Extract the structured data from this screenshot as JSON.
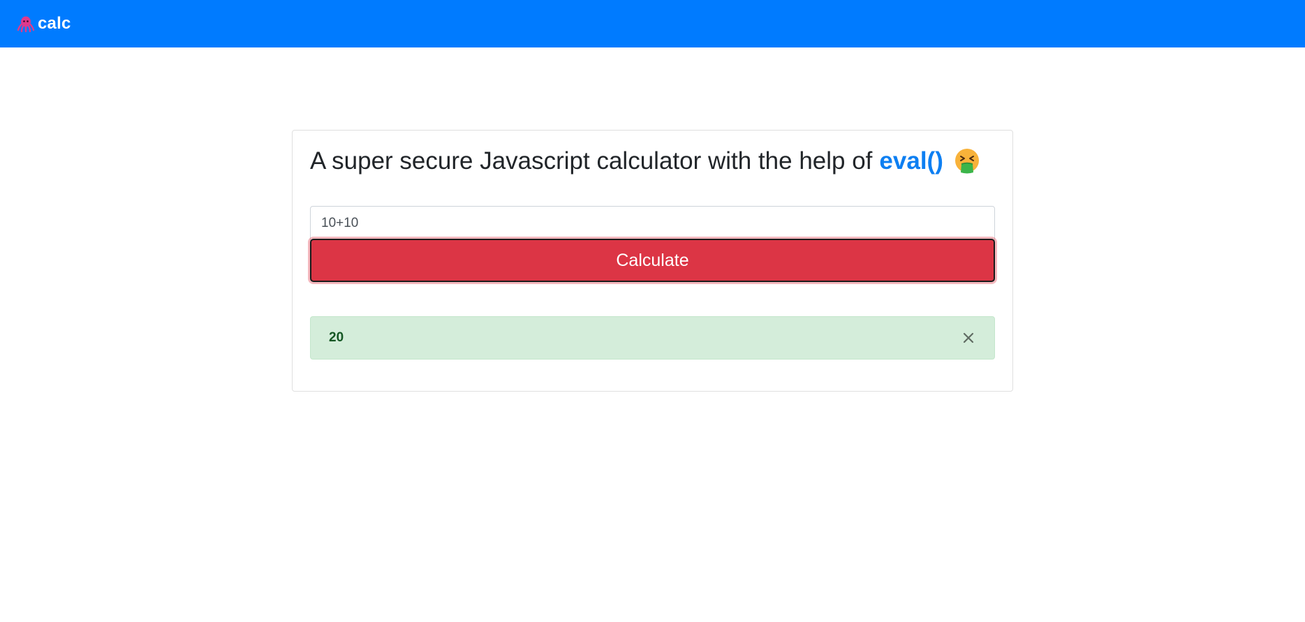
{
  "navbar": {
    "brand_label": "calc",
    "brand_icon": "octopus-icon",
    "background": "#007bff"
  },
  "main": {
    "heading_text": "A super secure Javascript calculator with the help of",
    "heading_accent": "eval()",
    "heading_emoji": "vomiting-face-icon",
    "accent_color": "#0d7ff2"
  },
  "form": {
    "expression_value": "10+10",
    "calculate_label": "Calculate",
    "button_color": "#dc3545"
  },
  "result": {
    "value": "20",
    "close_label": "×",
    "background": "#d4edda",
    "text_color": "#155724"
  }
}
